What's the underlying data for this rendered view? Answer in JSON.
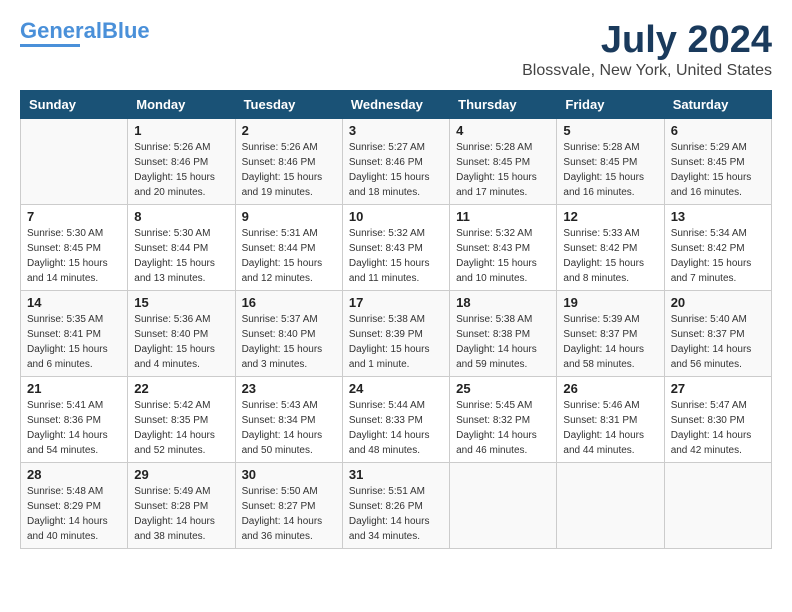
{
  "header": {
    "logo_line1": "General",
    "logo_line2": "Blue",
    "month": "July 2024",
    "location": "Blossvale, New York, United States"
  },
  "days_of_week": [
    "Sunday",
    "Monday",
    "Tuesday",
    "Wednesday",
    "Thursday",
    "Friday",
    "Saturday"
  ],
  "weeks": [
    [
      {
        "day": "",
        "info": ""
      },
      {
        "day": "1",
        "info": "Sunrise: 5:26 AM\nSunset: 8:46 PM\nDaylight: 15 hours\nand 20 minutes."
      },
      {
        "day": "2",
        "info": "Sunrise: 5:26 AM\nSunset: 8:46 PM\nDaylight: 15 hours\nand 19 minutes."
      },
      {
        "day": "3",
        "info": "Sunrise: 5:27 AM\nSunset: 8:46 PM\nDaylight: 15 hours\nand 18 minutes."
      },
      {
        "day": "4",
        "info": "Sunrise: 5:28 AM\nSunset: 8:45 PM\nDaylight: 15 hours\nand 17 minutes."
      },
      {
        "day": "5",
        "info": "Sunrise: 5:28 AM\nSunset: 8:45 PM\nDaylight: 15 hours\nand 16 minutes."
      },
      {
        "day": "6",
        "info": "Sunrise: 5:29 AM\nSunset: 8:45 PM\nDaylight: 15 hours\nand 16 minutes."
      }
    ],
    [
      {
        "day": "7",
        "info": "Sunrise: 5:30 AM\nSunset: 8:45 PM\nDaylight: 15 hours\nand 14 minutes."
      },
      {
        "day": "8",
        "info": "Sunrise: 5:30 AM\nSunset: 8:44 PM\nDaylight: 15 hours\nand 13 minutes."
      },
      {
        "day": "9",
        "info": "Sunrise: 5:31 AM\nSunset: 8:44 PM\nDaylight: 15 hours\nand 12 minutes."
      },
      {
        "day": "10",
        "info": "Sunrise: 5:32 AM\nSunset: 8:43 PM\nDaylight: 15 hours\nand 11 minutes."
      },
      {
        "day": "11",
        "info": "Sunrise: 5:32 AM\nSunset: 8:43 PM\nDaylight: 15 hours\nand 10 minutes."
      },
      {
        "day": "12",
        "info": "Sunrise: 5:33 AM\nSunset: 8:42 PM\nDaylight: 15 hours\nand 8 minutes."
      },
      {
        "day": "13",
        "info": "Sunrise: 5:34 AM\nSunset: 8:42 PM\nDaylight: 15 hours\nand 7 minutes."
      }
    ],
    [
      {
        "day": "14",
        "info": "Sunrise: 5:35 AM\nSunset: 8:41 PM\nDaylight: 15 hours\nand 6 minutes."
      },
      {
        "day": "15",
        "info": "Sunrise: 5:36 AM\nSunset: 8:40 PM\nDaylight: 15 hours\nand 4 minutes."
      },
      {
        "day": "16",
        "info": "Sunrise: 5:37 AM\nSunset: 8:40 PM\nDaylight: 15 hours\nand 3 minutes."
      },
      {
        "day": "17",
        "info": "Sunrise: 5:38 AM\nSunset: 8:39 PM\nDaylight: 15 hours\nand 1 minute."
      },
      {
        "day": "18",
        "info": "Sunrise: 5:38 AM\nSunset: 8:38 PM\nDaylight: 14 hours\nand 59 minutes."
      },
      {
        "day": "19",
        "info": "Sunrise: 5:39 AM\nSunset: 8:37 PM\nDaylight: 14 hours\nand 58 minutes."
      },
      {
        "day": "20",
        "info": "Sunrise: 5:40 AM\nSunset: 8:37 PM\nDaylight: 14 hours\nand 56 minutes."
      }
    ],
    [
      {
        "day": "21",
        "info": "Sunrise: 5:41 AM\nSunset: 8:36 PM\nDaylight: 14 hours\nand 54 minutes."
      },
      {
        "day": "22",
        "info": "Sunrise: 5:42 AM\nSunset: 8:35 PM\nDaylight: 14 hours\nand 52 minutes."
      },
      {
        "day": "23",
        "info": "Sunrise: 5:43 AM\nSunset: 8:34 PM\nDaylight: 14 hours\nand 50 minutes."
      },
      {
        "day": "24",
        "info": "Sunrise: 5:44 AM\nSunset: 8:33 PM\nDaylight: 14 hours\nand 48 minutes."
      },
      {
        "day": "25",
        "info": "Sunrise: 5:45 AM\nSunset: 8:32 PM\nDaylight: 14 hours\nand 46 minutes."
      },
      {
        "day": "26",
        "info": "Sunrise: 5:46 AM\nSunset: 8:31 PM\nDaylight: 14 hours\nand 44 minutes."
      },
      {
        "day": "27",
        "info": "Sunrise: 5:47 AM\nSunset: 8:30 PM\nDaylight: 14 hours\nand 42 minutes."
      }
    ],
    [
      {
        "day": "28",
        "info": "Sunrise: 5:48 AM\nSunset: 8:29 PM\nDaylight: 14 hours\nand 40 minutes."
      },
      {
        "day": "29",
        "info": "Sunrise: 5:49 AM\nSunset: 8:28 PM\nDaylight: 14 hours\nand 38 minutes."
      },
      {
        "day": "30",
        "info": "Sunrise: 5:50 AM\nSunset: 8:27 PM\nDaylight: 14 hours\nand 36 minutes."
      },
      {
        "day": "31",
        "info": "Sunrise: 5:51 AM\nSunset: 8:26 PM\nDaylight: 14 hours\nand 34 minutes."
      },
      {
        "day": "",
        "info": ""
      },
      {
        "day": "",
        "info": ""
      },
      {
        "day": "",
        "info": ""
      }
    ]
  ]
}
